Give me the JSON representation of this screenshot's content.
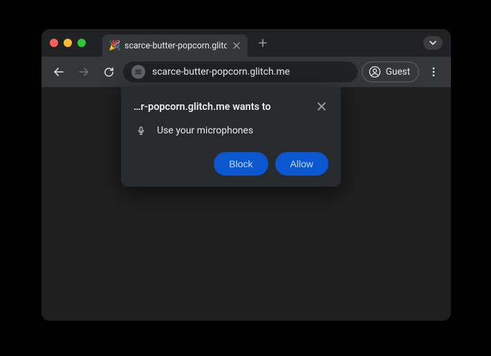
{
  "tab": {
    "title": "scarce-butter-popcorn.glitch",
    "favicon": "🎉"
  },
  "toolbar": {
    "url": "scarce-butter-popcorn.glitch.me",
    "guest_label": "Guest"
  },
  "permission": {
    "title": "…r-popcorn.glitch.me wants to",
    "item_label": "Use your microphones",
    "block_label": "Block",
    "allow_label": "Allow"
  }
}
